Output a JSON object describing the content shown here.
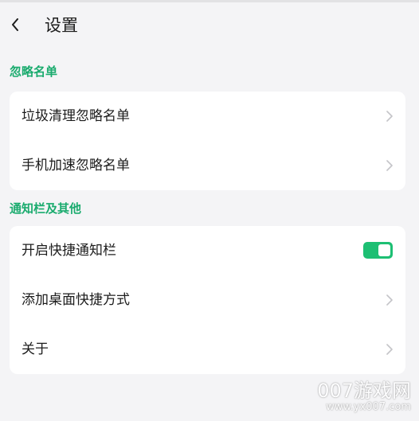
{
  "header": {
    "title": "设置",
    "back_icon": "chevron-left-icon"
  },
  "sections": [
    {
      "label": "忽略名单",
      "items": [
        {
          "label": "垃圾清理忽略名单",
          "control": "chevron-right-icon"
        },
        {
          "label": "手机加速忽略名单",
          "control": "chevron-right-icon"
        }
      ]
    },
    {
      "label": "通知栏及其他",
      "items": [
        {
          "label": "开启快捷通知栏",
          "control": "toggle",
          "toggle_on": true
        },
        {
          "label": "添加桌面快捷方式",
          "control": "chevron-right-icon"
        },
        {
          "label": "关于",
          "control": "chevron-right-icon"
        }
      ]
    }
  ],
  "watermark": {
    "main": "007游戏网",
    "sub": "www.yx007.com"
  },
  "colors": {
    "accent": "#1aab6e",
    "toggle": "#1dbf73",
    "background": "#f4f4f6",
    "card": "#ffffff"
  }
}
